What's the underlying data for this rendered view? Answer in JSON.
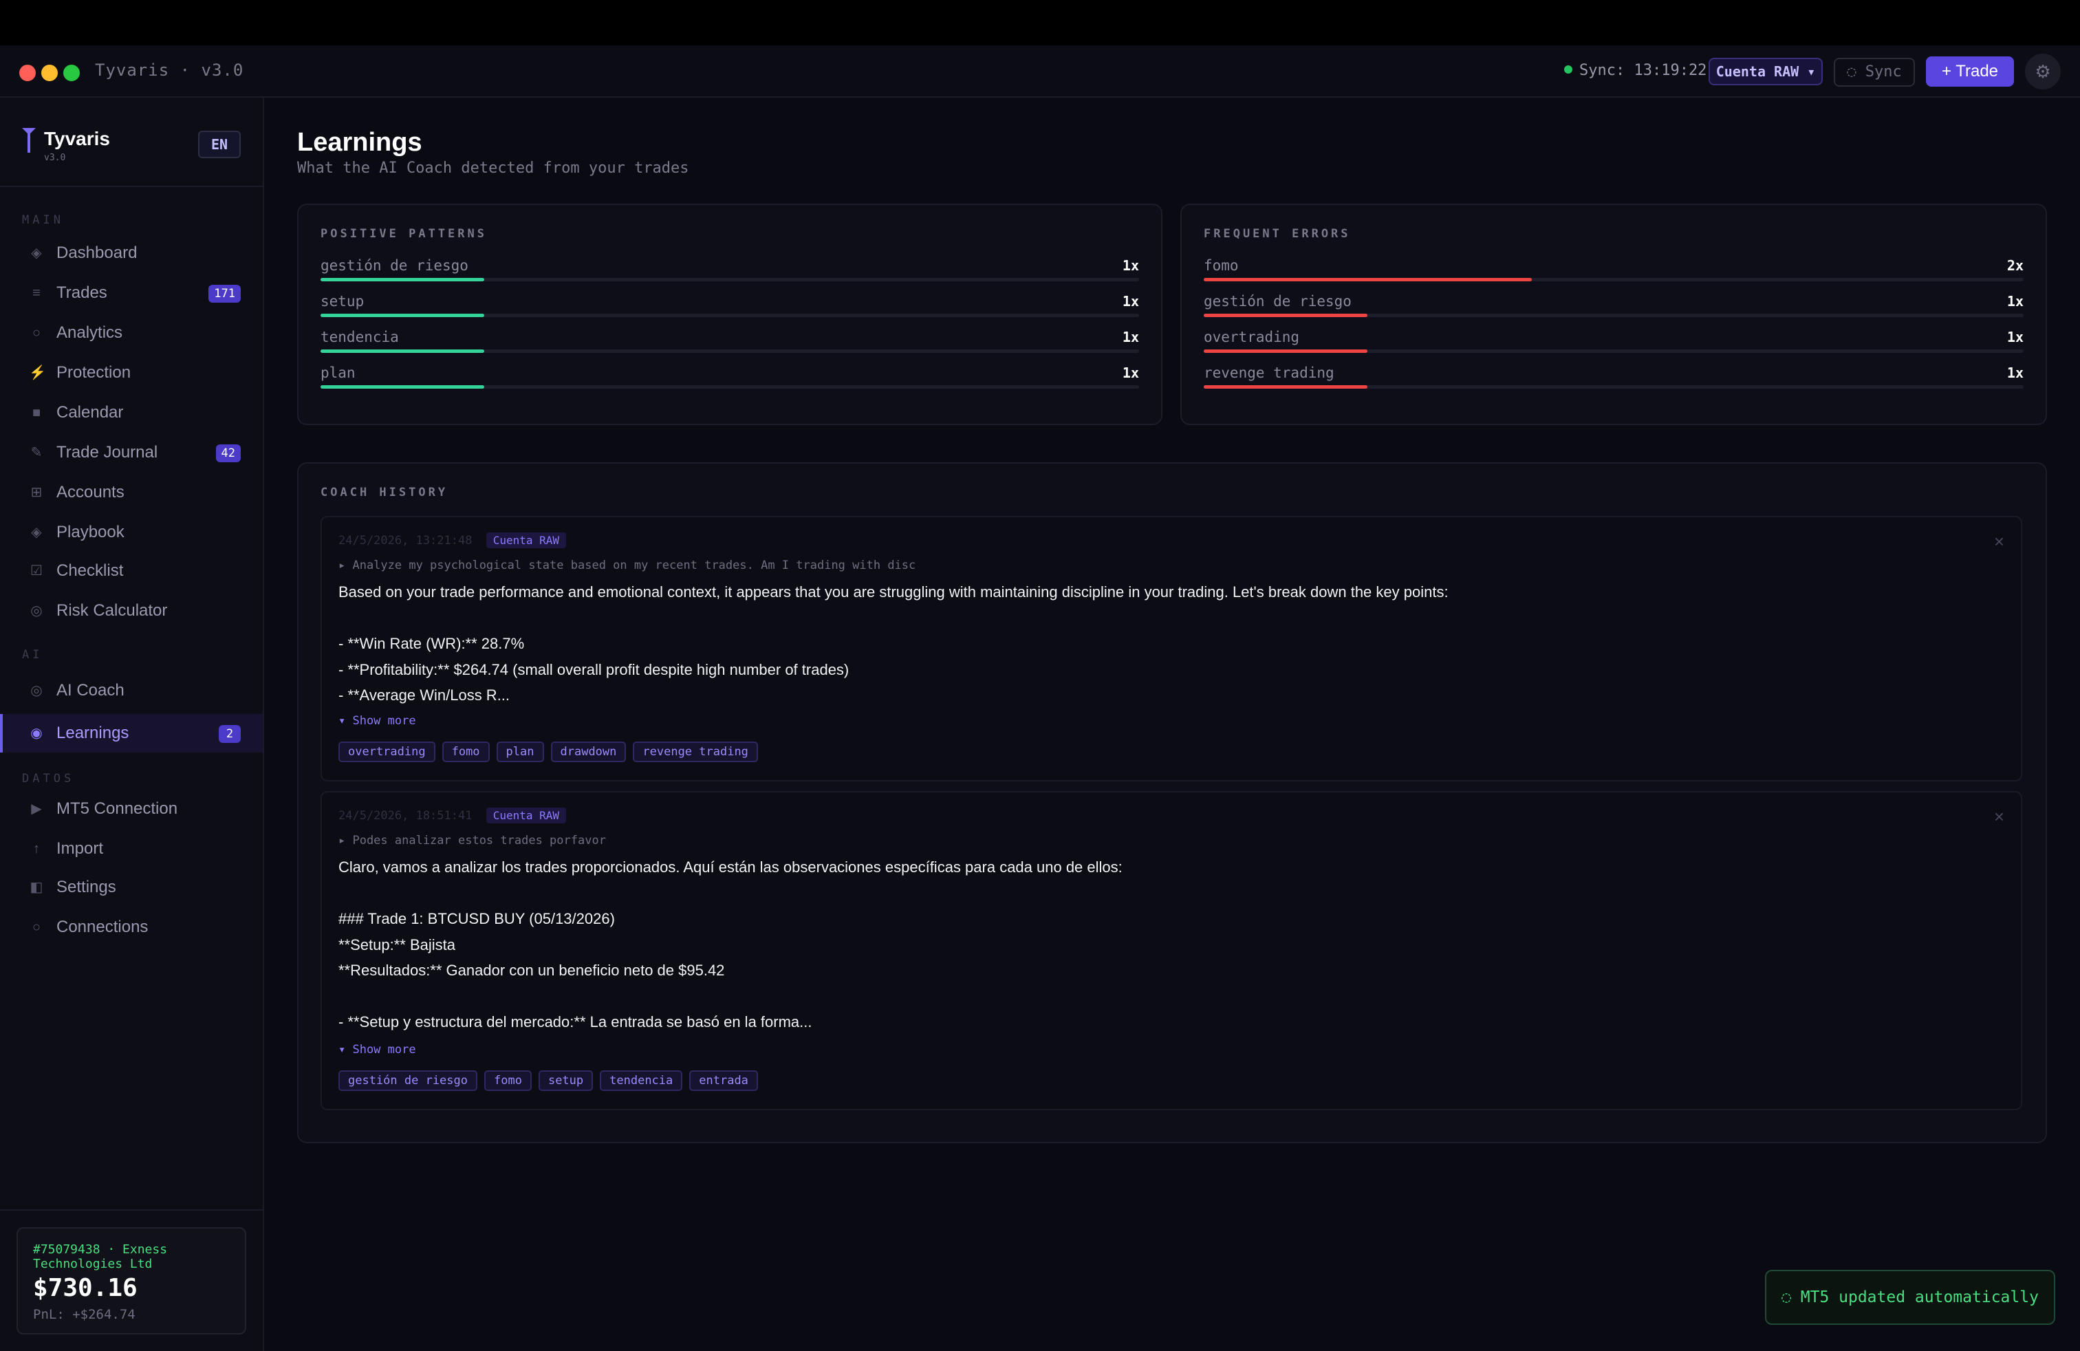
{
  "window": {
    "title": "Tyvaris · v3.0",
    "sync_status": "Sync: 13:19:22",
    "account_selector": "Cuenta RAW ▾",
    "sync_button": "◌ Sync",
    "trade_button": "+ Trade",
    "settings_icon": "gear-icon",
    "traffic_lights": [
      "#ff5f57",
      "#febc2e",
      "#28c840"
    ]
  },
  "sidebar": {
    "brand": "Tyvaris",
    "version": "v3.0",
    "language": "EN",
    "sections": [
      {
        "label": "MAIN"
      },
      {
        "label": "AI"
      },
      {
        "label": "DATOS"
      }
    ],
    "items": [
      {
        "label": "Dashboard",
        "icon": "◈"
      },
      {
        "label": "Trades",
        "icon": "≡",
        "badge": "171"
      },
      {
        "label": "Analytics",
        "icon": "○"
      },
      {
        "label": "Protection",
        "icon": "⚡"
      },
      {
        "label": "Calendar",
        "icon": "■"
      },
      {
        "label": "Trade Journal",
        "icon": "✎",
        "badge": "42"
      },
      {
        "label": "Accounts",
        "icon": "⊞"
      },
      {
        "label": "Playbook",
        "icon": "◈"
      },
      {
        "label": "Checklist",
        "icon": "☑"
      },
      {
        "label": "Risk Calculator",
        "icon": "◎"
      },
      {
        "label": "AI Coach",
        "icon": "◎"
      },
      {
        "label": "Learnings",
        "icon": "◉",
        "badge": "2"
      },
      {
        "label": "MT5 Connection",
        "icon": "▶"
      },
      {
        "label": "Import",
        "icon": "↑"
      },
      {
        "label": "Settings",
        "icon": "◧"
      },
      {
        "label": "Connections",
        "icon": "○"
      }
    ],
    "account": {
      "id": "#75079438 · Exness Technologies Ltd",
      "balance": "$730.16",
      "pnl": "PnL: +$264.74"
    }
  },
  "main": {
    "title": "Learnings",
    "subtitle": "What the AI Coach detected from your trades",
    "positive": {
      "label": "POSITIVE PATTERNS",
      "color": "#34d399",
      "rows": [
        {
          "name": "gestión de riesgo",
          "count": "1x",
          "fill": 0.2
        },
        {
          "name": "setup",
          "count": "1x",
          "fill": 0.2
        },
        {
          "name": "tendencia",
          "count": "1x",
          "fill": 0.2
        },
        {
          "name": "plan",
          "count": "1x",
          "fill": 0.2
        }
      ]
    },
    "errors": {
      "label": "FREQUENT ERRORS",
      "color": "#ef4444",
      "rows": [
        {
          "name": "fomo",
          "count": "2x",
          "fill": 0.4
        },
        {
          "name": "gestión de riesgo",
          "count": "1x",
          "fill": 0.2
        },
        {
          "name": "overtrading",
          "count": "1x",
          "fill": 0.2
        },
        {
          "name": "revenge trading",
          "count": "1x",
          "fill": 0.2
        }
      ]
    },
    "history": {
      "label": "COACH HISTORY",
      "entries": [
        {
          "date": "24/5/2026, 13:21:48",
          "account": "Cuenta RAW",
          "prompt": "▸ Analyze my psychological state based on my recent trades. Am I trading with disc",
          "body": "Based on your trade performance and emotional context, it appears that you are struggling with maintaining discipline in your trading. Let's break down the key points:\n\n- **Win Rate (WR):** 28.7%\n- **Profitability:** $264.74 (small overall profit despite high number of trades)\n- **Average Win/Loss R...",
          "show_more": "▾ Show more",
          "tags": [
            "overtrading",
            "fomo",
            "plan",
            "drawdown",
            "revenge trading"
          ]
        },
        {
          "date": "24/5/2026, 18:51:41",
          "account": "Cuenta RAW",
          "prompt": "▸ Podes analizar estos trades porfavor",
          "body": "Claro, vamos a analizar los trades proporcionados. Aquí están las observaciones específicas para cada uno de ellos:\n\n### Trade 1: BTCUSD BUY (05/13/2026)\n**Setup:** Bajista\n**Resultados:** Ganador con un beneficio neto de $95.42\n\n- **Setup y estructura del mercado:** La entrada se basó en la forma...",
          "show_more": "▾ Show more",
          "tags": [
            "gestión de riesgo",
            "fomo",
            "setup",
            "tendencia",
            "entrada"
          ]
        }
      ]
    }
  },
  "toast": "◌ MT5 updated automatically"
}
